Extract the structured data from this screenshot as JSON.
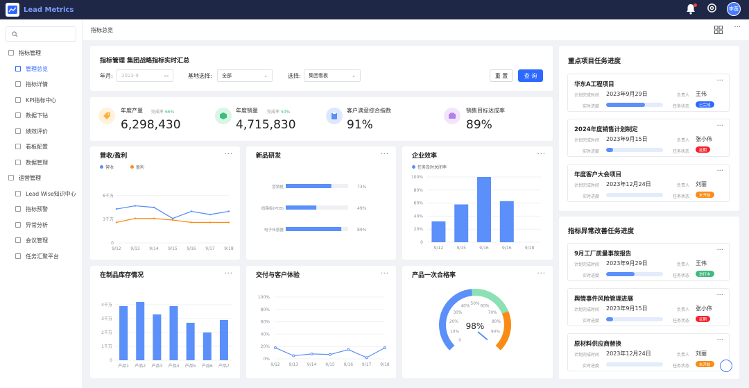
{
  "app": {
    "name": "Lead Metrics",
    "avatar": "李茵"
  },
  "colors": {
    "accent": "#2d68ff",
    "green": "#3dbd7d",
    "red": "#f5222d",
    "orange": "#fa8c16",
    "blue": "#5b8ff9"
  },
  "sidebar": {
    "group1": "指标管理",
    "items1": [
      "管理总览",
      "指标详情",
      "KPI指标中心",
      "数据下钻",
      "绩效评价",
      "看板配置",
      "数据管理"
    ],
    "group2": "运营管理",
    "items2": [
      "Lead Wise知识中心",
      "指标预警",
      "异常分析",
      "会议管理",
      "任务汇聚平台"
    ]
  },
  "breadcrumb": "指标总览",
  "filter": {
    "title": "指标管理 集团战略指标实时汇总",
    "year_label": "年月:",
    "year_placeholder": "2023-9",
    "base_label": "基地选择:",
    "base_value": "全部",
    "select_label": "选择:",
    "select_value": "集团看板",
    "reset": "重 置",
    "query": "查 询"
  },
  "kpis": [
    {
      "label": "年度产量",
      "rate_label": "完成率",
      "rate": "66%",
      "value": "6,298,430",
      "icon": "tag-icon",
      "color": "#fbb03b"
    },
    {
      "label": "年度销量",
      "rate_label": "完成率",
      "rate": "50%",
      "value": "4,715,830",
      "icon": "box-icon",
      "color": "#3dbd7d"
    },
    {
      "label": "客户满意综合指数",
      "rate_label": "",
      "rate": "",
      "value": "91%",
      "icon": "clipboard-icon",
      "color": "#5b8ff9"
    },
    {
      "label": "销售目标达成率",
      "rate_label": "",
      "rate": "",
      "value": "89%",
      "icon": "wallet-icon",
      "color": "#b37feb"
    }
  ],
  "charts": {
    "revenue": {
      "title": "营收/盈利",
      "legend": [
        "营收",
        "盈利"
      ]
    },
    "rnd": {
      "title": "新品研发"
    },
    "efficiency": {
      "title": "企业效率",
      "legend": [
        "任务及时关闭率"
      ]
    },
    "wip": {
      "title": "在制品库存情况"
    },
    "delivery": {
      "title": "交付与客户体验"
    },
    "quality": {
      "title": "产品一次合格率",
      "value": "98%"
    }
  },
  "chart_data": [
    {
      "type": "line",
      "title": "营收/盈利",
      "x": [
        "9/12",
        "9/13",
        "9/14",
        "9/15",
        "9/16",
        "9/17",
        "9/18"
      ],
      "series": [
        {
          "name": "营收",
          "values": [
            4.3,
            4.7,
            4.5,
            3.1,
            4.0,
            3.6,
            4.0
          ]
        },
        {
          "name": "盈利",
          "values": [
            2.6,
            3.1,
            3.1,
            2.9,
            2.6,
            2.6,
            2.6
          ]
        }
      ],
      "yticks": [
        "0",
        "3千万",
        "6千万"
      ],
      "ylim": [
        0,
        8
      ]
    },
    {
      "type": "bar",
      "title": "新品研发",
      "orientation": "horizontal",
      "categories": [
        "营销框",
        "线路板(PCB)",
        "电子传感器"
      ],
      "values": [
        73,
        49,
        89
      ],
      "value_labels": [
        "73%",
        "49%",
        "89%"
      ],
      "xlim": [
        0,
        100
      ]
    },
    {
      "type": "bar",
      "title": "企业效率",
      "categories": [
        "9/12",
        "9/15",
        "9/16",
        "9/16",
        "9/18"
      ],
      "series": [
        {
          "name": "任务及时关闭率",
          "values": [
            32,
            58,
            100,
            63,
            0
          ]
        }
      ],
      "yticks": [
        "0",
        "20%",
        "40%",
        "60%",
        "80%",
        "100%"
      ],
      "ylim": [
        0,
        100
      ]
    },
    {
      "type": "bar",
      "title": "在制品库存情况",
      "categories": [
        "产品1",
        "产品2",
        "产品3",
        "产品4",
        "产品5",
        "产品6",
        "产品7"
      ],
      "values": [
        3.9,
        4.2,
        3.3,
        3.9,
        2.7,
        2.0,
        2.9
      ],
      "yticks": [
        "0",
        "1千万",
        "2千万",
        "3千万",
        "4千万"
      ],
      "ylim": [
        0,
        4.4
      ]
    },
    {
      "type": "line",
      "title": "交付与客户体验",
      "x": [
        "9/12",
        "9/13",
        "9/14",
        "9/15",
        "9/16",
        "9/17",
        "9/18"
      ],
      "values": [
        18,
        5,
        8,
        7,
        15,
        2,
        18
      ],
      "yticks": [
        "0%",
        "20%",
        "40%",
        "60%",
        "80%",
        "100%"
      ],
      "ylim": [
        0,
        100
      ]
    },
    {
      "type": "gauge",
      "title": "产品一次合格率",
      "value": 98,
      "ticks": [
        "0",
        "10%",
        "20%",
        "30%",
        "40%",
        "50%",
        "60%",
        "70%",
        "80%",
        "90%"
      ]
    }
  ],
  "projects": {
    "title": "重点项目任务进度",
    "items": [
      {
        "name": "华东A工程项目",
        "plan_label": "计划完成时间",
        "date": "2023年9月29日",
        "owner_label": "负责人",
        "owner": "王伟",
        "prog_label": "实时进度",
        "progress": 0.68,
        "status_label": "任务状态",
        "status": "已完成",
        "status_color": "#2d68ff"
      },
      {
        "name": "2024年度销售计划制定",
        "plan_label": "计划完成时间",
        "date": "2023年9月15日",
        "owner_label": "负责人",
        "owner": "张小伟",
        "prog_label": "实时进度",
        "progress": 0.12,
        "status_label": "任务状态",
        "status": "延期",
        "status_color": "#f5222d"
      },
      {
        "name": "年度客户大会项目",
        "plan_label": "计划完成时间",
        "date": "2023年12月24日",
        "owner_label": "负责人",
        "owner": "刘丽",
        "prog_label": "实时进度",
        "progress": 0,
        "status_label": "任务状态",
        "status": "未开始",
        "status_color": "#fa8c16"
      }
    ]
  },
  "anomalies": {
    "title": "指标异常改善任务进度",
    "items": [
      {
        "name": "9月工厂质量事故报告",
        "plan_label": "计划完成时间",
        "date": "2023年9月29日",
        "owner_label": "负责人",
        "owner": "王伟",
        "prog_label": "实时进度",
        "progress": 0.5,
        "status_label": "任务状态",
        "status": "进行中",
        "status_color": "#3dbd7d"
      },
      {
        "name": "舆情事件风险管理进展",
        "plan_label": "计划完成时间",
        "date": "2023年9月15日",
        "owner_label": "负责人",
        "owner": "张小伟",
        "prog_label": "实时进度",
        "progress": 0.12,
        "status_label": "任务状态",
        "status": "延期",
        "status_color": "#f5222d"
      },
      {
        "name": "原材料供应商替换",
        "plan_label": "计划完成时间",
        "date": "2023年12月24日",
        "owner_label": "负责人",
        "owner": "刘丽",
        "prog_label": "实时进度",
        "progress": 0,
        "status_label": "任务状态",
        "status": "未开始",
        "status_color": "#fa8c16"
      }
    ]
  }
}
